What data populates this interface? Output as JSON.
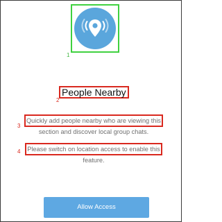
{
  "icon": {
    "name": "location-pin-icon",
    "color": "#5aa6dc",
    "annotation_index": "1"
  },
  "title": {
    "text": "People Nearby",
    "annotation_index": "2"
  },
  "description": {
    "line1": "Quickly add people nearby who are viewing this",
    "line2": "section and discover local group chats.",
    "annotation_index": "3"
  },
  "permission_note": {
    "line1": "Please switch on location access to enable this",
    "line2": "feature.",
    "annotation_index": "4"
  },
  "button": {
    "label": "Allow Access",
    "color": "#5ea8e2"
  }
}
